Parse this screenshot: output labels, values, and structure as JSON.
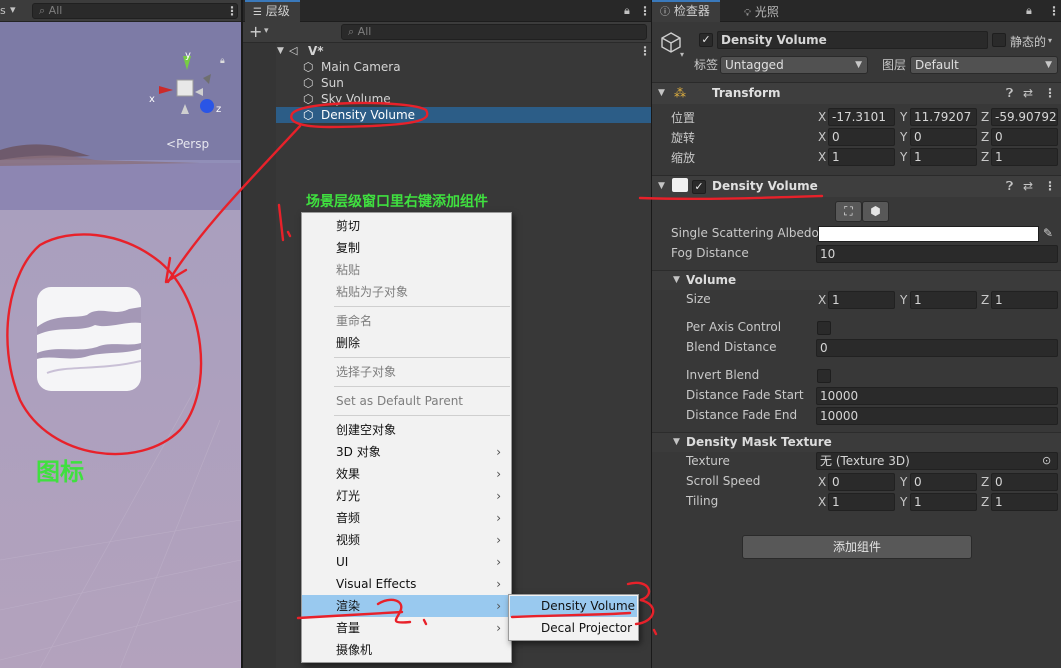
{
  "scene": {
    "dropdown_label": "s",
    "search_placeholder": "All",
    "gizmo_y": "y",
    "gizmo_x": "x",
    "gizmo_z": "z",
    "persp_label": "Persp"
  },
  "hierarchy": {
    "tab_label": "层级",
    "search_placeholder": "All",
    "scene_name": "V*",
    "items": [
      {
        "label": "Main Camera"
      },
      {
        "label": "Sun"
      },
      {
        "label": "Sky Volume"
      },
      {
        "label": "Density Volume"
      }
    ]
  },
  "context_menu": {
    "items": [
      {
        "label": "剪切",
        "enabled": true
      },
      {
        "label": "复制",
        "enabled": true
      },
      {
        "label": "粘贴",
        "enabled": false
      },
      {
        "label": "粘贴为子对象",
        "enabled": false
      },
      {
        "label": "重命名",
        "enabled": false
      },
      {
        "label": "删除",
        "enabled": true
      },
      {
        "label": "选择子对象",
        "enabled": false
      },
      {
        "label": "Set as Default Parent",
        "enabled": false
      },
      {
        "label": "创建空对象",
        "enabled": true
      },
      {
        "label": "3D 对象",
        "enabled": true,
        "submenu": true
      },
      {
        "label": "效果",
        "enabled": true,
        "submenu": true
      },
      {
        "label": "灯光",
        "enabled": true,
        "submenu": true
      },
      {
        "label": "音频",
        "enabled": true,
        "submenu": true
      },
      {
        "label": "视频",
        "enabled": true,
        "submenu": true
      },
      {
        "label": "UI",
        "enabled": true,
        "submenu": true
      },
      {
        "label": "Visual Effects",
        "enabled": true,
        "submenu": true
      },
      {
        "label": "渲染",
        "enabled": true,
        "submenu": true,
        "highlighted": true
      },
      {
        "label": "音量",
        "enabled": true,
        "submenu": true
      },
      {
        "label": "摄像机",
        "enabled": true
      }
    ],
    "submenu_items": [
      {
        "label": "Density Volume",
        "highlighted": true
      },
      {
        "label": "Decal Projector"
      }
    ]
  },
  "inspector": {
    "tab_inspector": "检查器",
    "tab_lighting": "光照",
    "object_name": "Density Volume",
    "static_label": "静态的",
    "tag_label": "标签",
    "tag_value": "Untagged",
    "layer_label": "图层",
    "layer_value": "Default",
    "transform": {
      "title": "Transform",
      "position_label": "位置",
      "rotation_label": "旋转",
      "scale_label": "缩放",
      "position": {
        "x": "-17.3101",
        "y": "11.79207",
        "z": "-59.90792"
      },
      "rotation": {
        "x": "0",
        "y": "0",
        "z": "0"
      },
      "scale": {
        "x": "1",
        "y": "1",
        "z": "1"
      }
    },
    "density_volume": {
      "title": "Density Volume",
      "albedo_label": "Single Scattering Albedo",
      "fog_distance_label": "Fog Distance",
      "fog_distance": "10",
      "volume_section": "Volume",
      "size_label": "Size",
      "size": {
        "x": "1",
        "y": "1",
        "z": "1"
      },
      "per_axis_label": "Per Axis Control",
      "blend_distance_label": "Blend Distance",
      "blend_distance": "0",
      "invert_blend_label": "Invert Blend",
      "fade_start_label": "Distance Fade Start",
      "fade_start": "10000",
      "fade_end_label": "Distance Fade End",
      "fade_end": "10000",
      "mask_section": "Density Mask Texture",
      "texture_label": "Texture",
      "texture_value": "无 (Texture 3D)",
      "scroll_speed_label": "Scroll Speed",
      "scroll_speed": {
        "x": "0",
        "y": "0",
        "z": "0"
      },
      "tiling_label": "Tiling",
      "tiling": {
        "x": "1",
        "y": "1",
        "z": "1"
      }
    },
    "add_component": "添加组件",
    "axis": {
      "x": "X",
      "y": "Y",
      "z": "Z"
    }
  },
  "annotations": {
    "step1_note": "场景层级窗口里右键添加组件",
    "icon_note": "图标"
  },
  "colors": {
    "selection": "#2c5d87",
    "menu_highlight": "#99c9ef",
    "annotation_red": "#e8212a",
    "annotation_green": "#3fe03f"
  }
}
